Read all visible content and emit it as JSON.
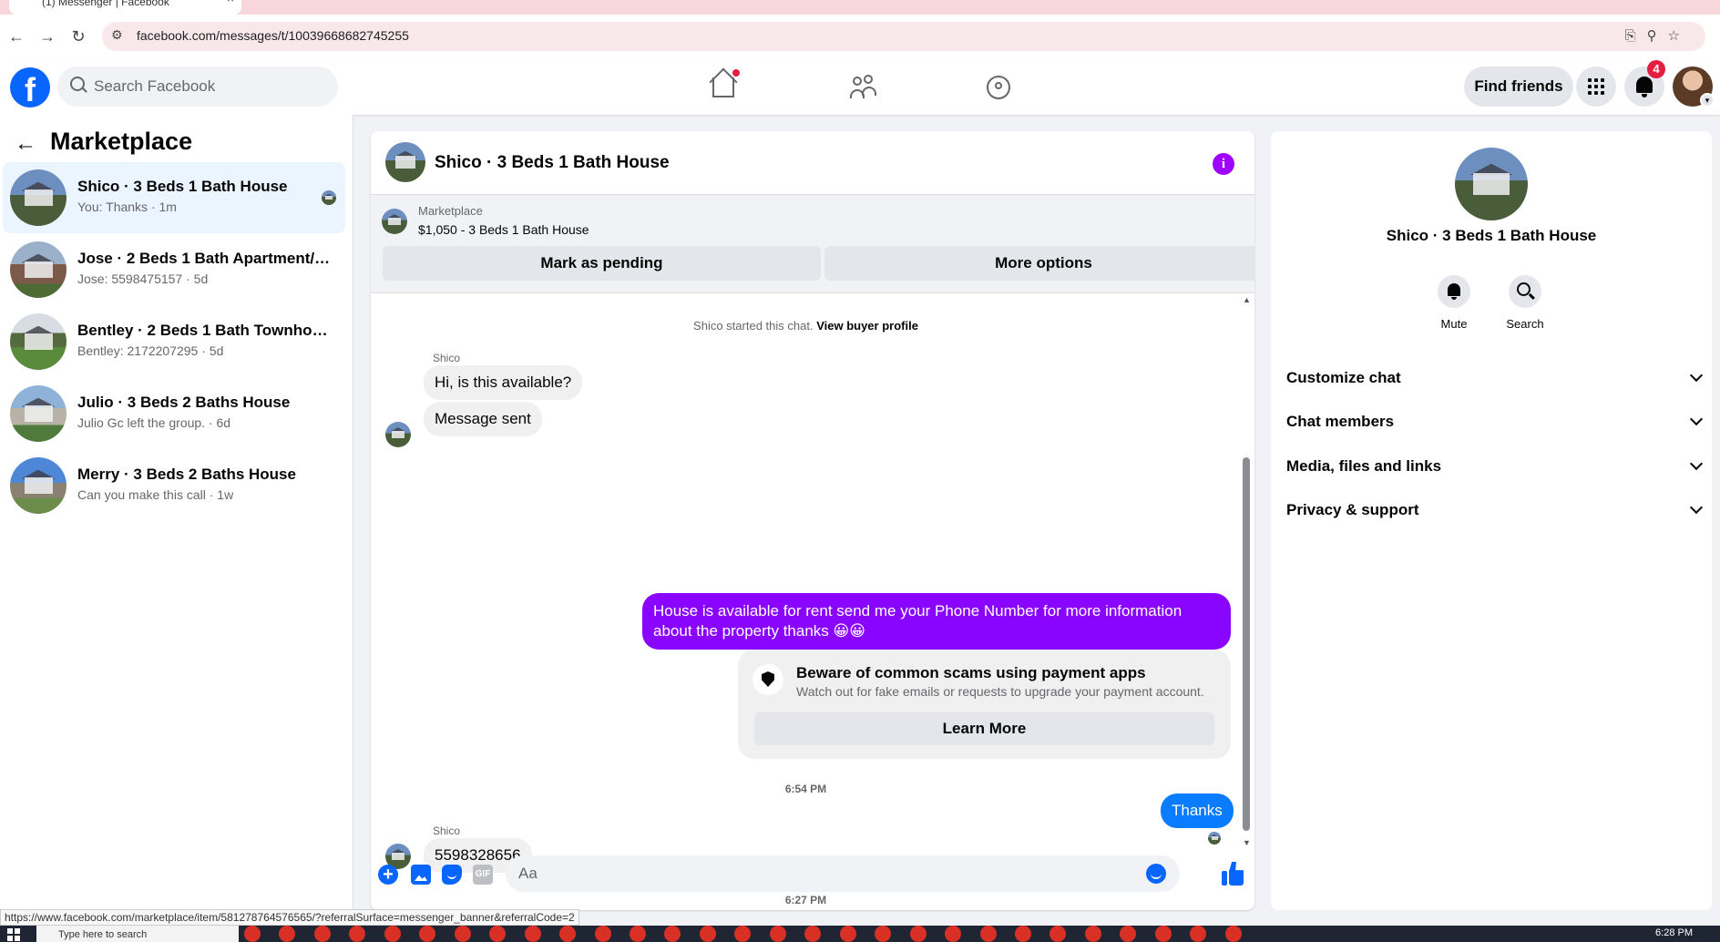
{
  "browser": {
    "tab_title": "(1) Messenger | Facebook",
    "url": "facebook.com/messages/t/10039668682745255"
  },
  "header": {
    "search_placeholder": "Search Facebook",
    "find_friends_label": "Find friends",
    "notification_count": "4",
    "icons": [
      "facebook-logo",
      "home-icon",
      "friends-icon",
      "groups-icon",
      "menu-grid-icon",
      "bell-icon",
      "avatar"
    ]
  },
  "sidebar": {
    "title": "Marketplace",
    "conversations": [
      {
        "name": "Shico · 3 Beds 1 Bath House",
        "snippet": "You: Thanks · 1m",
        "active": true
      },
      {
        "name": "Jose · 2 Beds 1 Bath Apartment/co...",
        "snippet": "Jose: 5598475157 · 5d",
        "active": false
      },
      {
        "name": "Bentley · 2 Beds 1 Bath Townhouse",
        "snippet": "Bentley: 2172207295 · 5d",
        "active": false
      },
      {
        "name": "Julio · 3 Beds 2 Baths House",
        "snippet": "Julio Gc left the group. · 6d",
        "active": false
      },
      {
        "name": "Merry · 3 Beds 2 Baths House",
        "snippet": "Can you make this call · 1w",
        "active": false
      }
    ]
  },
  "chat": {
    "title": "Shico · 3 Beds 1 Bath House",
    "marketplace_label": "Marketplace",
    "listing": "$1,050 - 3 Beds 1 Bath House",
    "mark_pending_label": "Mark as pending",
    "more_options_label": "More options",
    "started_text": "Shico started this chat.",
    "view_buyer_label": "View buyer profile",
    "sender": "Shico",
    "msg1": "Hi, is this available?",
    "msg2": "Message sent",
    "outgoing1": "House is available for rent send me your Phone Number for more information about the property thanks 😀😀",
    "scam_title": "Beware of common scams using payment apps",
    "scam_sub": "Watch out for fake emails or requests to upgrade your payment account.",
    "learn_more_label": "Learn More",
    "time1": "6:54 PM",
    "msg3": "5598328656",
    "time2": "6:27 PM",
    "outgoing2": "Thanks",
    "composer_placeholder": "Aa",
    "gif_label": "GIF"
  },
  "details": {
    "name": "Shico · 3 Beds 1 Bath House",
    "mute_label": "Mute",
    "search_label": "Search",
    "sections": [
      "Customize chat",
      "Chat members",
      "Media, files and links",
      "Privacy & support"
    ]
  },
  "status_url": "https://www.facebook.com/marketplace/item/581278764576565/?referralSurface=messenger_banner&referralCode=2",
  "taskbar": {
    "search_placeholder": "Type here to search",
    "clock": "6:28 PM"
  },
  "colors": {
    "fb_blue": "#0866ff",
    "purple_bubble": "#8a05ff",
    "blue_bubble": "#0a7cff",
    "active_convo": "#ebf5ff"
  }
}
